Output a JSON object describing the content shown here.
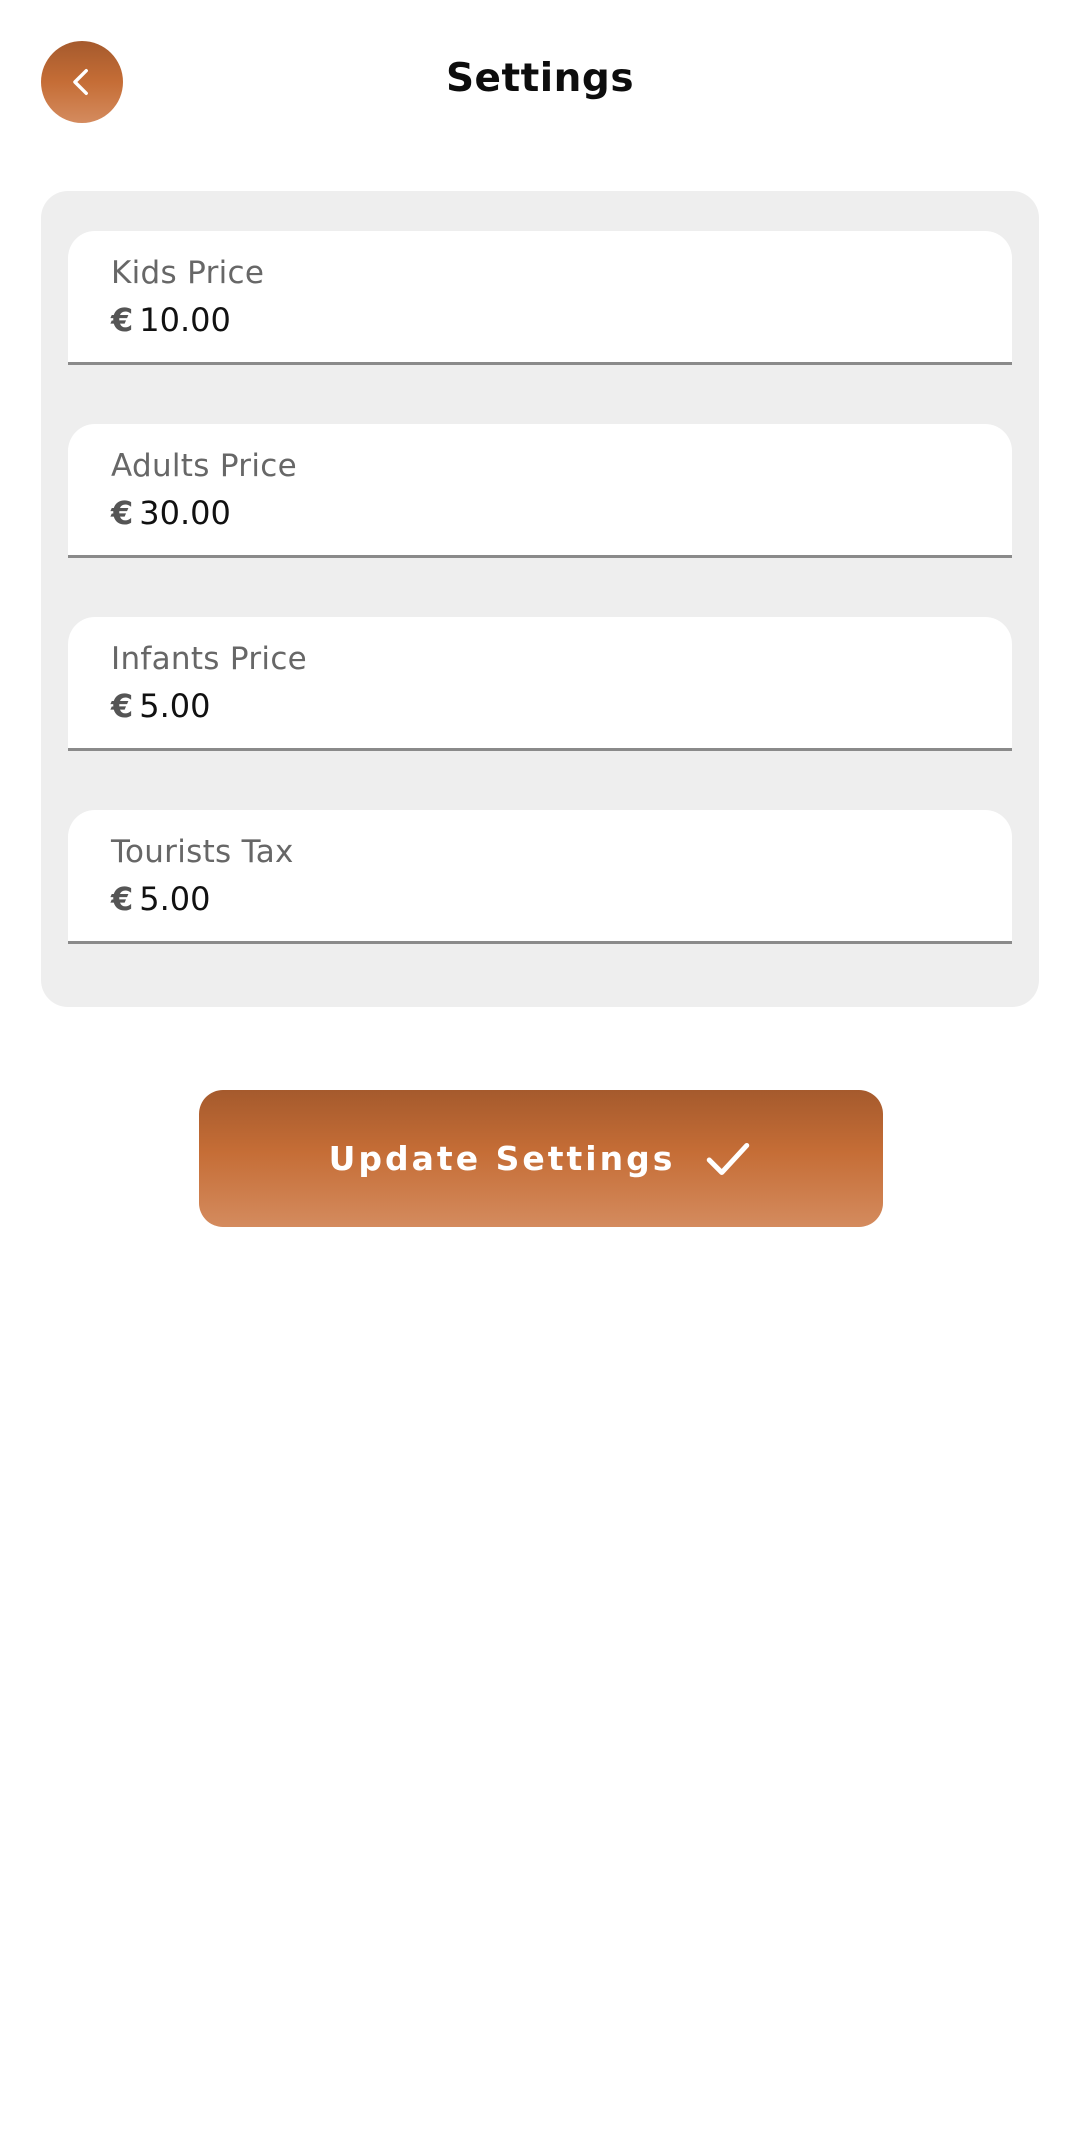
{
  "header": {
    "title": "Settings",
    "back_icon": "chevron-left-icon"
  },
  "fields": [
    {
      "label": "Kids Price",
      "prefix": "€",
      "value": "10.00"
    },
    {
      "label": "Adults Price",
      "prefix": "€",
      "value": "30.00"
    },
    {
      "label": "Infants Price",
      "prefix": "€",
      "value": "5.00"
    },
    {
      "label": "Tourists Tax",
      "prefix": "€",
      "value": "5.00"
    }
  ],
  "update_button": {
    "label": "Update Settings",
    "icon": "check-icon"
  },
  "colors": {
    "accent": "#c56d36",
    "card_background": "#eeeeee"
  }
}
